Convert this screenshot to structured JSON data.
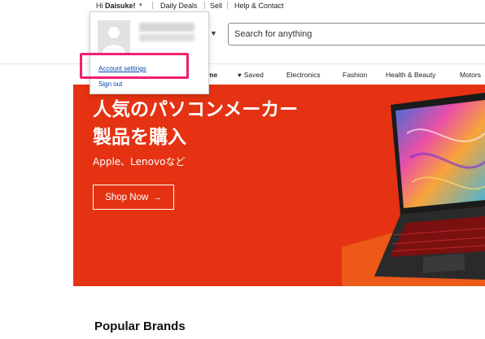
{
  "topnav": {
    "greeting_prefix": "Hi ",
    "user_name": "Daisuke!",
    "daily_deals": "Daily Deals",
    "sell": "Sell",
    "help_contact": "Help & Contact"
  },
  "search": {
    "placeholder": "Search for anything"
  },
  "account_menu": {
    "account_settings": "Account settings",
    "sign_out": "Sign out"
  },
  "category_nav": {
    "home": "me",
    "saved": "Saved",
    "items": [
      "Electronics",
      "Fashion",
      "Health & Beauty",
      "Motors"
    ]
  },
  "hero": {
    "title": "人気のパソコンメーカー製品を購入",
    "subtitle": "Apple、Lenovoなど",
    "button": "Shop Now",
    "button_arrow": "→"
  },
  "popular_brands": {
    "heading": "Popular Brands"
  },
  "colors": {
    "hero_bg": "#e53212",
    "highlight": "#f0206f",
    "link": "#0645ad"
  }
}
